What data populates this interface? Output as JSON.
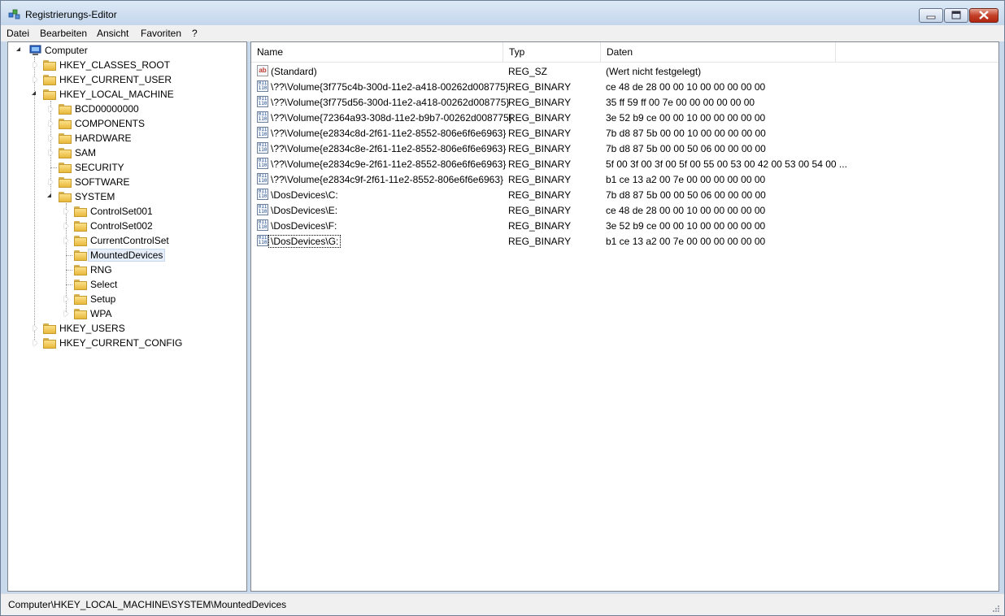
{
  "window": {
    "title": "Registrierungs-Editor",
    "accent": "#c4412a"
  },
  "menu": [
    "Datei",
    "Bearbeiten",
    "Ansicht",
    "Favoriten",
    "?"
  ],
  "tree": {
    "root": "Computer",
    "hives": [
      "HKEY_CLASSES_ROOT",
      "HKEY_CURRENT_USER",
      "HKEY_LOCAL_MACHINE",
      "HKEY_USERS",
      "HKEY_CURRENT_CONFIG"
    ],
    "hklm_children": [
      "BCD00000000",
      "COMPONENTS",
      "HARDWARE",
      "SAM",
      "SECURITY",
      "SOFTWARE",
      "SYSTEM"
    ],
    "system_children": [
      "ControlSet001",
      "ControlSet002",
      "CurrentControlSet",
      "MountedDevices",
      "RNG",
      "Select",
      "Setup",
      "WPA"
    ],
    "selected": "MountedDevices"
  },
  "list": {
    "columns": [
      "Name",
      "Typ",
      "Daten"
    ],
    "rows": [
      {
        "name": "(Standard)",
        "type": "REG_SZ",
        "data": "(Wert nicht festgelegt)",
        "icon": "string-value-icon"
      },
      {
        "name": "\\??\\Volume{3f775c4b-300d-11e2-a418-00262d008775}",
        "type": "REG_BINARY",
        "data": "ce 48 de 28 00 00 10 00 00 00 00 00",
        "icon": "binary-value-icon"
      },
      {
        "name": "\\??\\Volume{3f775d56-300d-11e2-a418-00262d008775}",
        "type": "REG_BINARY",
        "data": "35 ff 59 ff 00 7e 00 00 00 00 00 00",
        "icon": "binary-value-icon"
      },
      {
        "name": "\\??\\Volume{72364a93-308d-11e2-b9b7-00262d008775}",
        "type": "REG_BINARY",
        "data": "3e 52 b9 ce 00 00 10 00 00 00 00 00",
        "icon": "binary-value-icon"
      },
      {
        "name": "\\??\\Volume{e2834c8d-2f61-11e2-8552-806e6f6e6963}",
        "type": "REG_BINARY",
        "data": "7b d8 87 5b 00 00 10 00 00 00 00 00",
        "icon": "binary-value-icon"
      },
      {
        "name": "\\??\\Volume{e2834c8e-2f61-11e2-8552-806e6f6e6963}",
        "type": "REG_BINARY",
        "data": "7b d8 87 5b 00 00 50 06 00 00 00 00",
        "icon": "binary-value-icon"
      },
      {
        "name": "\\??\\Volume{e2834c9e-2f61-11e2-8552-806e6f6e6963}",
        "type": "REG_BINARY",
        "data": "5f 00 3f 00 3f 00 5f 00 55 00 53 00 42 00 53 00 54 00 ...",
        "icon": "binary-value-icon"
      },
      {
        "name": "\\??\\Volume{e2834c9f-2f61-11e2-8552-806e6f6e6963}",
        "type": "REG_BINARY",
        "data": "b1 ce 13 a2 00 7e 00 00 00 00 00 00",
        "icon": "binary-value-icon"
      },
      {
        "name": "\\DosDevices\\C:",
        "type": "REG_BINARY",
        "data": "7b d8 87 5b 00 00 50 06 00 00 00 00",
        "icon": "binary-value-icon"
      },
      {
        "name": "\\DosDevices\\E:",
        "type": "REG_BINARY",
        "data": "ce 48 de 28 00 00 10 00 00 00 00 00",
        "icon": "binary-value-icon"
      },
      {
        "name": "\\DosDevices\\F:",
        "type": "REG_BINARY",
        "data": "3e 52 b9 ce 00 00 10 00 00 00 00 00",
        "icon": "binary-value-icon"
      },
      {
        "name": "\\DosDevices\\G:",
        "type": "REG_BINARY",
        "data": "b1 ce 13 a2 00 7e 00 00 00 00 00 00",
        "icon": "binary-value-icon"
      }
    ]
  },
  "status": "Computer\\HKEY_LOCAL_MACHINE\\SYSTEM\\MountedDevices"
}
